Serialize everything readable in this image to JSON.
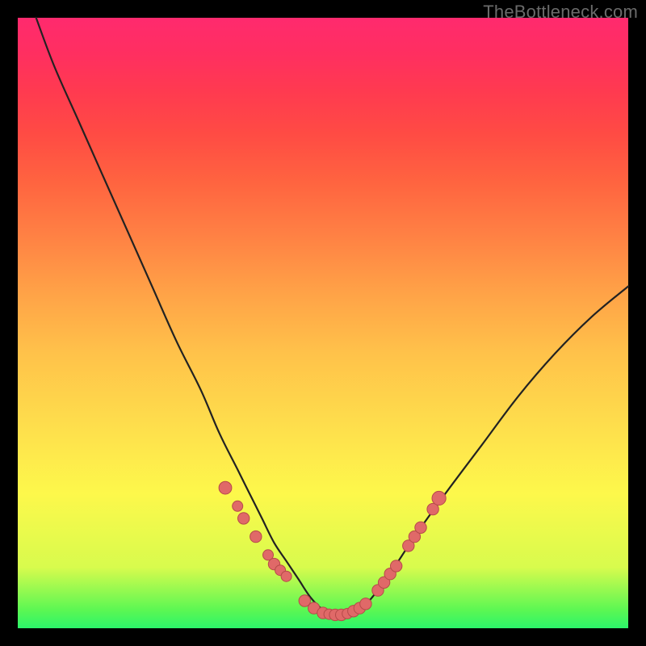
{
  "watermark": "TheBottleneck.com",
  "colors": {
    "frame": "#000000",
    "curve_stroke": "#222222",
    "marker_fill": "#e06968",
    "marker_stroke": "#b64a49",
    "gradient_top": "#ff2a6e",
    "gradient_mid": "#fdf84b",
    "gradient_bottom": "#2cf46a"
  },
  "chart_data": {
    "type": "line",
    "title": "",
    "xlabel": "",
    "ylabel": "",
    "xlim": [
      0,
      100
    ],
    "ylim": [
      0,
      100
    ],
    "grid": false,
    "series": [
      {
        "name": "bottleneck-curve",
        "x": [
          3,
          6,
          10,
          14,
          18,
          22,
          26,
          30,
          33,
          36,
          38,
          40,
          42,
          44,
          46,
          48,
          50,
          52,
          54,
          56,
          58,
          61,
          65,
          70,
          76,
          82,
          88,
          94,
          100
        ],
        "y": [
          100,
          92,
          83,
          74,
          65,
          56,
          47,
          39,
          32,
          26,
          22,
          18,
          14,
          11,
          8,
          5,
          3,
          2,
          2,
          3,
          5,
          9,
          15,
          22,
          30,
          38,
          45,
          51,
          56
        ],
        "note": "V-shaped curve; minimum near x≈53 with y≈2; left branch goes to 100% at left edge, right branch ~56% at right edge"
      }
    ],
    "markers": [
      {
        "x": 34,
        "y": 23,
        "r": 1.1
      },
      {
        "x": 36,
        "y": 20,
        "r": 0.9
      },
      {
        "x": 37,
        "y": 18,
        "r": 1.0
      },
      {
        "x": 39,
        "y": 15,
        "r": 1.0
      },
      {
        "x": 41,
        "y": 12,
        "r": 0.9
      },
      {
        "x": 42,
        "y": 10.5,
        "r": 1.0
      },
      {
        "x": 43,
        "y": 9.5,
        "r": 0.9
      },
      {
        "x": 44,
        "y": 8.5,
        "r": 0.9
      },
      {
        "x": 47,
        "y": 4.5,
        "r": 1.0
      },
      {
        "x": 48.5,
        "y": 3.3,
        "r": 1.0
      },
      {
        "x": 50,
        "y": 2.5,
        "r": 1.0
      },
      {
        "x": 51,
        "y": 2.3,
        "r": 0.9
      },
      {
        "x": 52,
        "y": 2.2,
        "r": 1.0
      },
      {
        "x": 53,
        "y": 2.2,
        "r": 1.0
      },
      {
        "x": 54,
        "y": 2.4,
        "r": 0.9
      },
      {
        "x": 55,
        "y": 2.8,
        "r": 1.0
      },
      {
        "x": 56,
        "y": 3.3,
        "r": 1.0
      },
      {
        "x": 57,
        "y": 4.0,
        "r": 1.0
      },
      {
        "x": 59,
        "y": 6.2,
        "r": 1.0
      },
      {
        "x": 60,
        "y": 7.5,
        "r": 1.0
      },
      {
        "x": 61,
        "y": 8.9,
        "r": 1.0
      },
      {
        "x": 62,
        "y": 10.2,
        "r": 1.0
      },
      {
        "x": 64,
        "y": 13.5,
        "r": 1.0
      },
      {
        "x": 65,
        "y": 15.0,
        "r": 1.0
      },
      {
        "x": 66,
        "y": 16.5,
        "r": 1.0
      },
      {
        "x": 68,
        "y": 19.5,
        "r": 1.0
      },
      {
        "x": 69,
        "y": 21.3,
        "r": 1.2
      }
    ],
    "marker_note": "salmon dots visible roughly on the lower third of the curve, clustered x≈34–69",
    "legend": null
  }
}
